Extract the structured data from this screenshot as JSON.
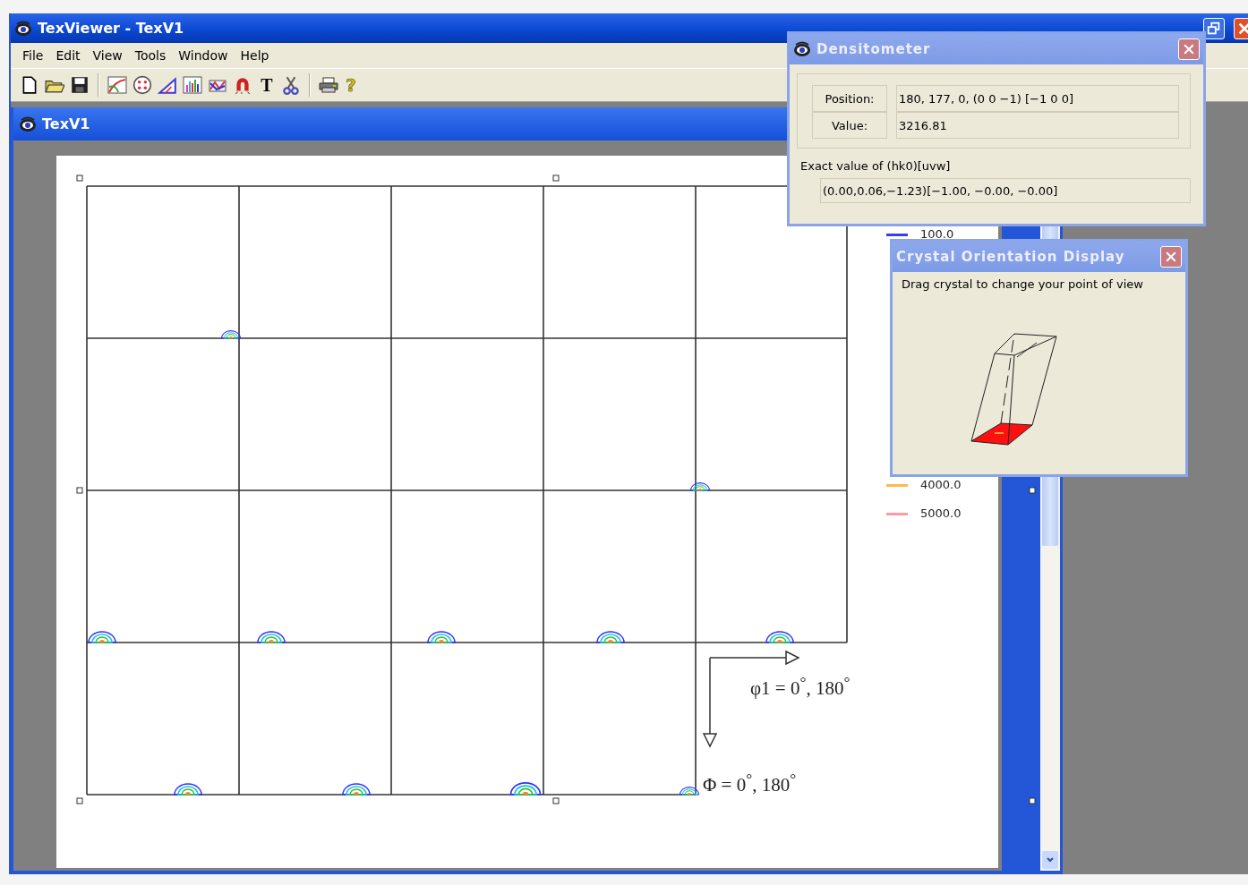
{
  "window": {
    "title": "TexViewer - TexV1"
  },
  "menu": [
    {
      "label": "File"
    },
    {
      "label": "Edit"
    },
    {
      "label": "View"
    },
    {
      "label": "Tools"
    },
    {
      "label": "Window"
    },
    {
      "label": "Help"
    }
  ],
  "toolbar": [
    {
      "kind": "new"
    },
    {
      "kind": "open"
    },
    {
      "kind": "save"
    },
    {
      "kind": "separator"
    },
    {
      "kind": "map"
    },
    {
      "kind": "pole"
    },
    {
      "kind": "triangle"
    },
    {
      "kind": "histogram"
    },
    {
      "kind": "network"
    },
    {
      "kind": "magnet"
    },
    {
      "kind": "text",
      "glyph": "T"
    },
    {
      "kind": "cut"
    },
    {
      "kind": "separator"
    },
    {
      "kind": "print"
    },
    {
      "kind": "help",
      "glyph": "?"
    }
  ],
  "document": {
    "title": "TexV1",
    "phi1_label": "φ1 = 0$^{°}$, 180$^{°}$",
    "Phi_label": "Φ = 0$^{°}$, 180$^{°}$",
    "legend": [
      {
        "label": "100.0",
        "color": "#3a3aff"
      },
      {
        "label": "4000.0",
        "color": "#ffb84a"
      },
      {
        "label": "5000.0",
        "color": "#ff9aa0"
      }
    ]
  },
  "densitometer": {
    "title": "Densitometer",
    "rows": [
      {
        "label": "Position:",
        "value": "180, 177, 0,  (0 0 −1) [−1 0 0]"
      },
      {
        "label": "Value:",
        "value": "3216.81"
      }
    ],
    "exact_label": "Exact value of (hk0)[uvw]",
    "exact_value": "(0.00,0.06,−1.23)[−1.00, −0.00, −0.00]"
  },
  "crystal_dialog": {
    "title": "Crystal Orientation Display",
    "hint": "Drag crystal to change your point of view"
  }
}
